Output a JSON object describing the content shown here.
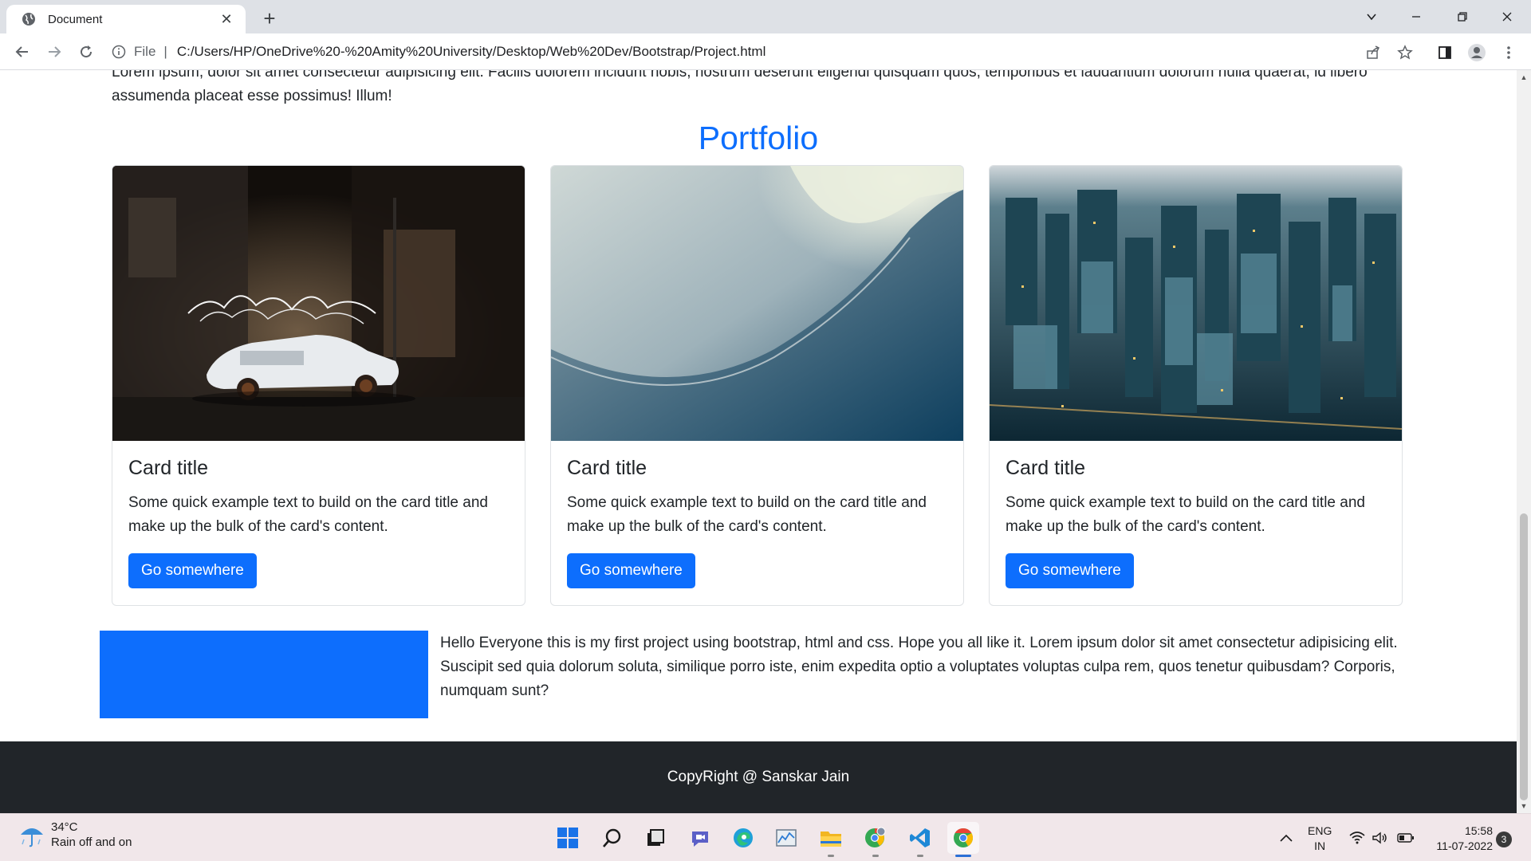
{
  "browser": {
    "tab_title": "Document",
    "address_scheme": "File",
    "address_url": "C:/Users/HP/OneDrive%20-%20Amity%20University/Desktop/Web%20Dev/Bootstrap/Project.html"
  },
  "page": {
    "intro_text": "Lorem ipsum, dolor sit amet consectetur adipisicing elit. Facilis dolorem incidunt nobis, nostrum deserunt eligendi quisquam quos, temporibus et laudantium dolorum nulla quaerat, id libero assumenda placeat esse possimus! Illum!",
    "portfolio_heading": "Portfolio",
    "cards": [
      {
        "title": "Card title",
        "text": "Some quick example text to build on the card title and make up the bulk of the card's content.",
        "button": "Go somewhere"
      },
      {
        "title": "Card title",
        "text": "Some quick example text to build on the card title and make up the bulk of the card's content.",
        "button": "Go somewhere"
      },
      {
        "title": "Card title",
        "text": "Some quick example text to build on the card title and make up the bulk of the card's content.",
        "button": "Go somewhere"
      }
    ],
    "about_text": "Hello Everyone this is my first project using bootstrap, html and css. Hope you all like it. Lorem ipsum dolor sit amet consectetur adipisicing elit. Suscipit sed quia dolorum soluta, similique porro iste, enim expedita optio a voluptates voluptas culpa rem, quos tenetur quibusdam? Corporis, numquam sunt?",
    "footer_text": "CopyRight @ Sanskar Jain"
  },
  "taskbar": {
    "weather_temp": "34°C",
    "weather_condition": "Rain off and on",
    "lang_top": "ENG",
    "lang_bottom": "IN",
    "time": "15:58",
    "date": "11-07-2022",
    "notification_count": "3"
  },
  "colors": {
    "primary": "#0d6efd",
    "footer_bg": "#212529",
    "taskbar_bg": "#f1e7ea"
  }
}
